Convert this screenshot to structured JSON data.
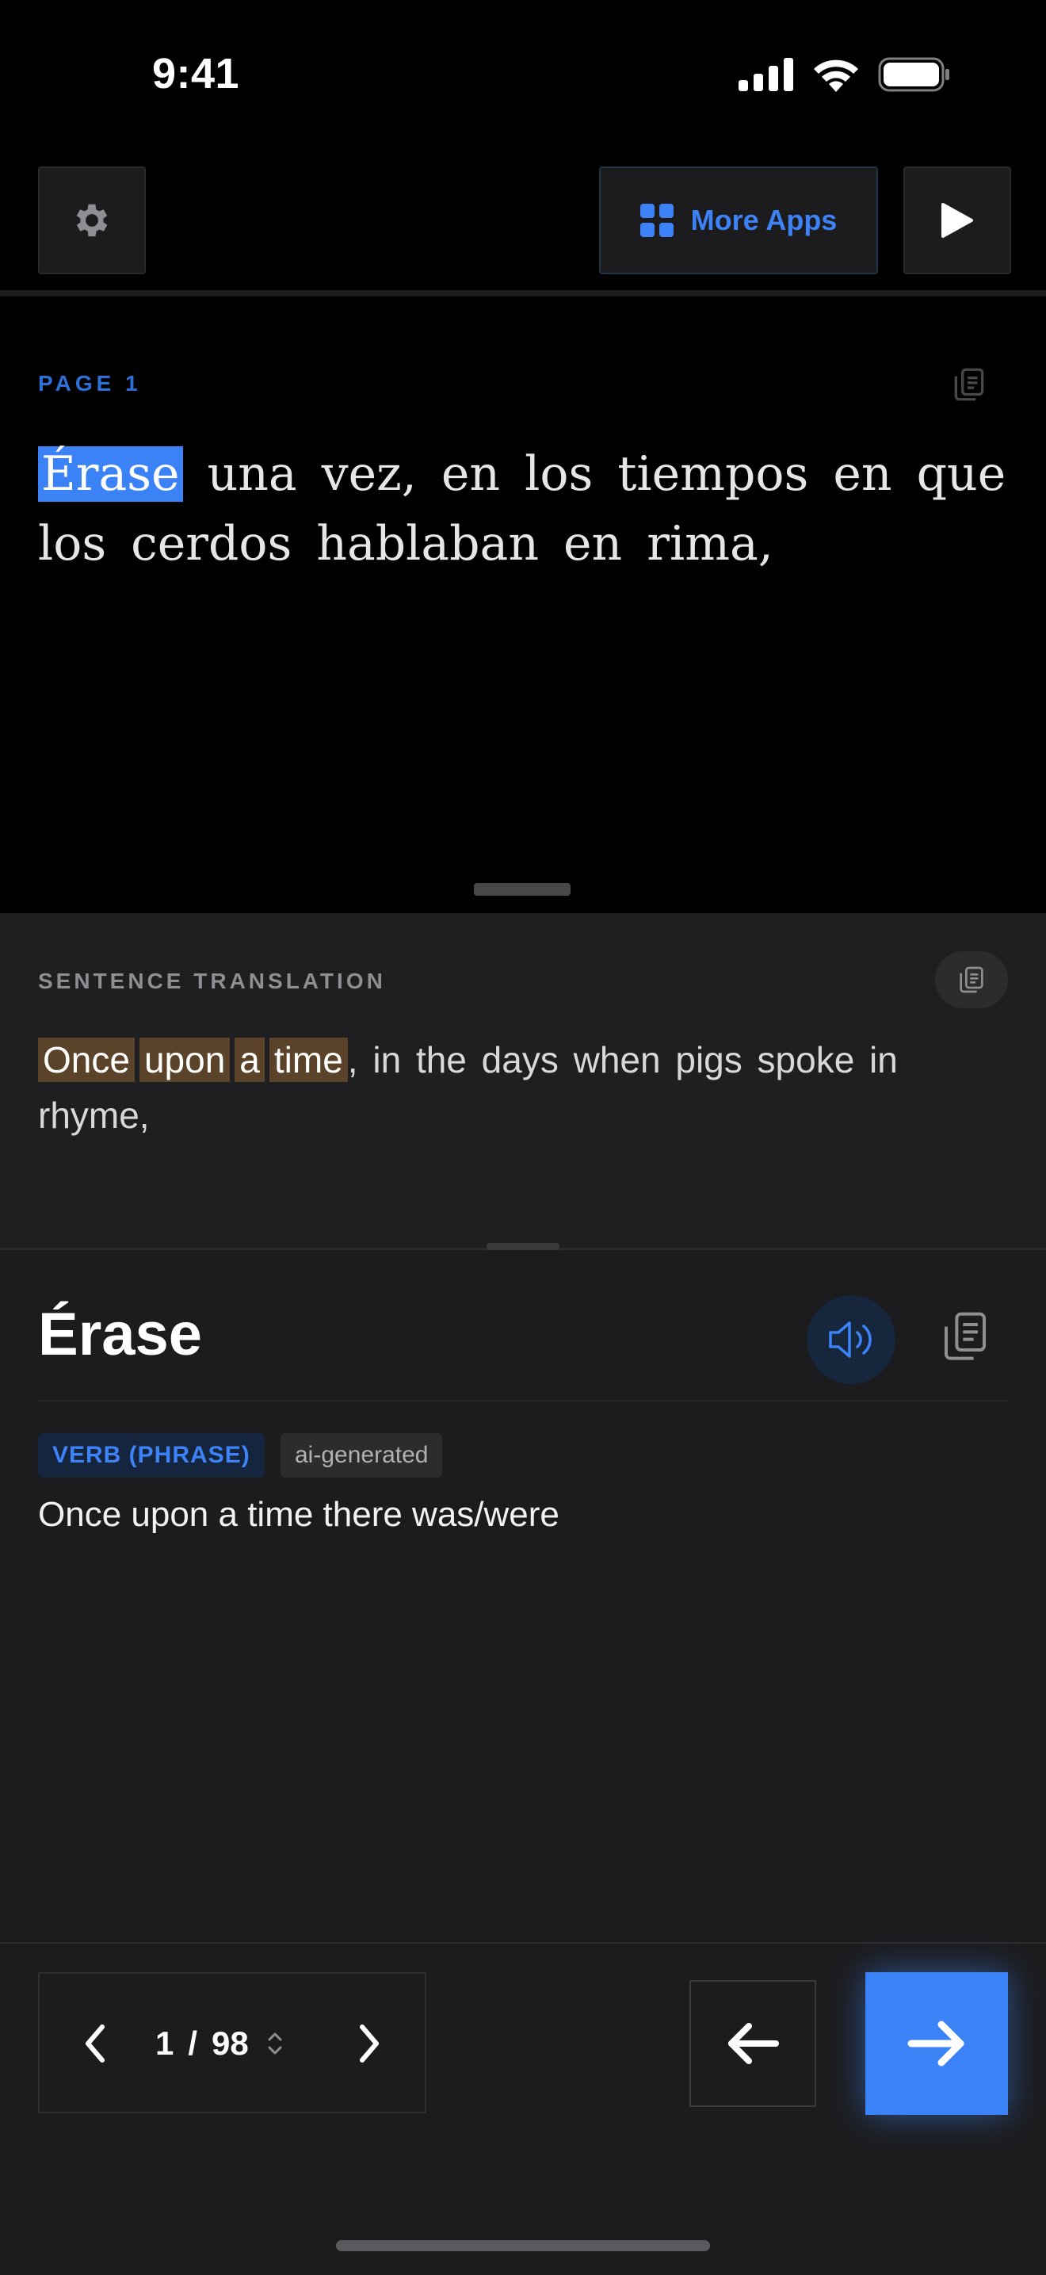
{
  "status_bar": {
    "time": "9:41"
  },
  "toolbar": {
    "settings_icon": "gear-icon",
    "more_apps_label": "More Apps",
    "more_apps_icon": "grid-icon",
    "play_icon": "play-icon"
  },
  "reader": {
    "page_label": "PAGE 1",
    "highlighted_word": "Érase",
    "text_rest_line1": " una vez, en los tiempos en que",
    "text_line2": "los cerdos hablaban en rima,"
  },
  "sentence_translation": {
    "title": "SENTENCE TRANSLATION",
    "highlighted_words": [
      "Once",
      "upon",
      "a",
      "time"
    ],
    "rest": ", in the days when pigs spoke in rhyme,"
  },
  "word_detail": {
    "word": "Érase",
    "part_of_speech": "VERB (PHRASE)",
    "source_badge": "ai-generated",
    "definition": "Once upon a time there was/were"
  },
  "pager": {
    "current": "1",
    "separator": "/",
    "total": "98"
  },
  "colors": {
    "accent": "#3b82f6",
    "highlight_translation": "#5a4328",
    "panel_bg": "#1c1c1e"
  }
}
